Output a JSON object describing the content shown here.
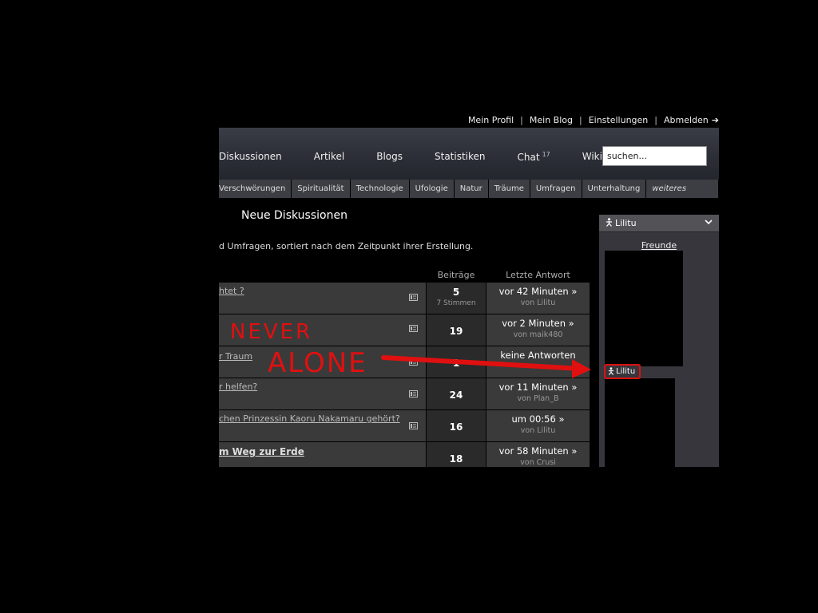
{
  "userlinks": [
    "Mein Profil",
    "Mein Blog",
    "Einstellungen",
    "Abmelden"
  ],
  "logout_arrow": "➔",
  "nav": {
    "items": [
      "Diskussionen",
      "Artikel",
      "Blogs",
      "Statistiken",
      "Chat",
      "Wiki"
    ],
    "chat_count": "17",
    "search_value": "suchen..."
  },
  "categories": [
    "Verschwörungen",
    "Spiritualität",
    "Technologie",
    "Ufologie",
    "Natur",
    "Träume",
    "Umfragen",
    "Unterhaltung",
    "weiteres"
  ],
  "main": {
    "heading": "Neue Diskussionen",
    "subtext": "d Umfragen, sortiert nach dem Zeitpunkt ihrer Erstellung.",
    "col_posts": "Beiträge",
    "col_last": "Letzte Antwort"
  },
  "rows": [
    {
      "title": "htet ?",
      "count": "5",
      "votes": "7 Stimmen",
      "last": "vor 42 Minuten »",
      "by": "von Lilitu"
    },
    {
      "title": "",
      "count": "19",
      "last": "vor 2 Minuten »",
      "by": "von maik480"
    },
    {
      "title": "r Traum",
      "count": "1",
      "last": "keine Antworten",
      "by": ""
    },
    {
      "title": "r helfen?",
      "count": "24",
      "last": "vor 11 Minuten »",
      "by": "von Plan_B"
    },
    {
      "title": "chen Prinzessin Kaoru Nakamaru gehört?",
      "count": "16",
      "last": "um 00:56 »",
      "by": "von Lilitu"
    },
    {
      "title": "m Weg zur Erde",
      "count": "18",
      "last": "vor 58 Minuten »",
      "by": "von Crusi"
    }
  ],
  "panel": {
    "username": "Lilitu",
    "friends_label": "Freunde",
    "tag_name": "Lilitu"
  },
  "annotation": {
    "line1": "NEVER",
    "line2": "ALONE",
    "color": "#e01010"
  },
  "icons": {
    "person": "person-icon",
    "chevron": "chevron-down-icon",
    "row": "thread-icon"
  }
}
